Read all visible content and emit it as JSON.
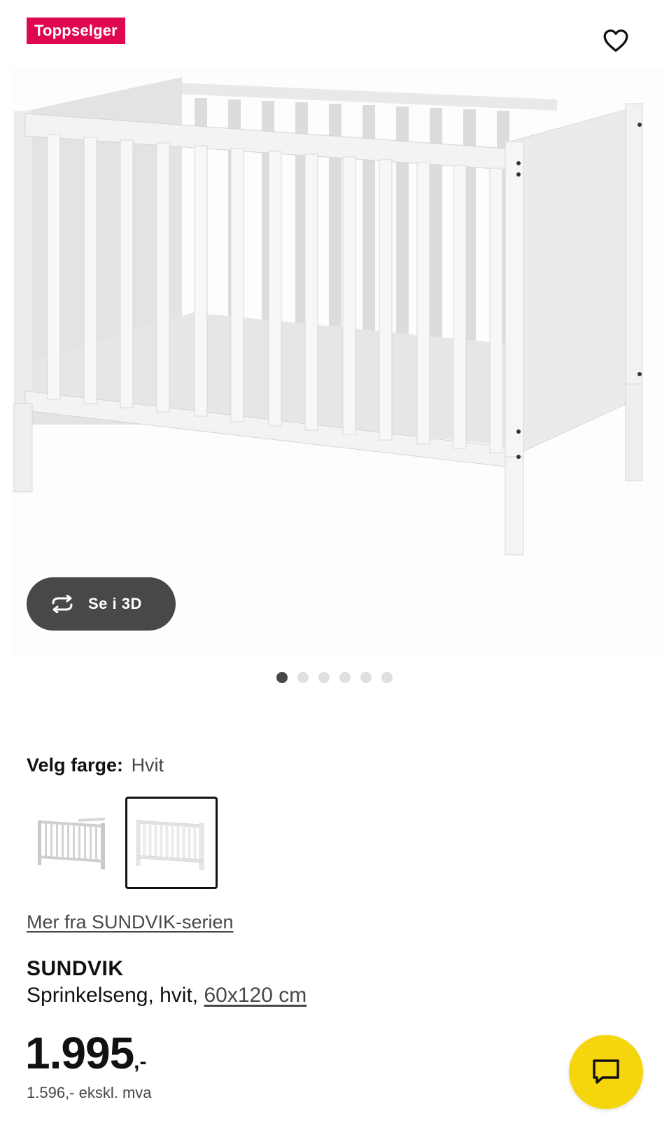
{
  "badge": {
    "label": "Toppselger",
    "color": "#e00751"
  },
  "favorite": {
    "icon": "heart-outline-icon"
  },
  "gallery": {
    "view_3d_label": "Se i 3D",
    "view_3d_icon": "rotate-3d-icon",
    "dots_total": 6,
    "active_dot": 1
  },
  "color_selector": {
    "label": "Velg farge:",
    "value": "Hvit",
    "swatches": [
      {
        "name": "grey-variant",
        "selected": false
      },
      {
        "name": "white-variant",
        "selected": true
      }
    ]
  },
  "series_link": "Mer fra SUNDVIK-serien",
  "product": {
    "name": "SUNDVIK",
    "description": "Sprinkelseng, hvit,",
    "size": "60x120 cm"
  },
  "price": {
    "amount": "1.995",
    "suffix": ",-"
  },
  "vat_note": "1.596,- ekskl. mva",
  "chat": {
    "icon": "chat-bubble-icon",
    "color": "#f5d60c"
  }
}
